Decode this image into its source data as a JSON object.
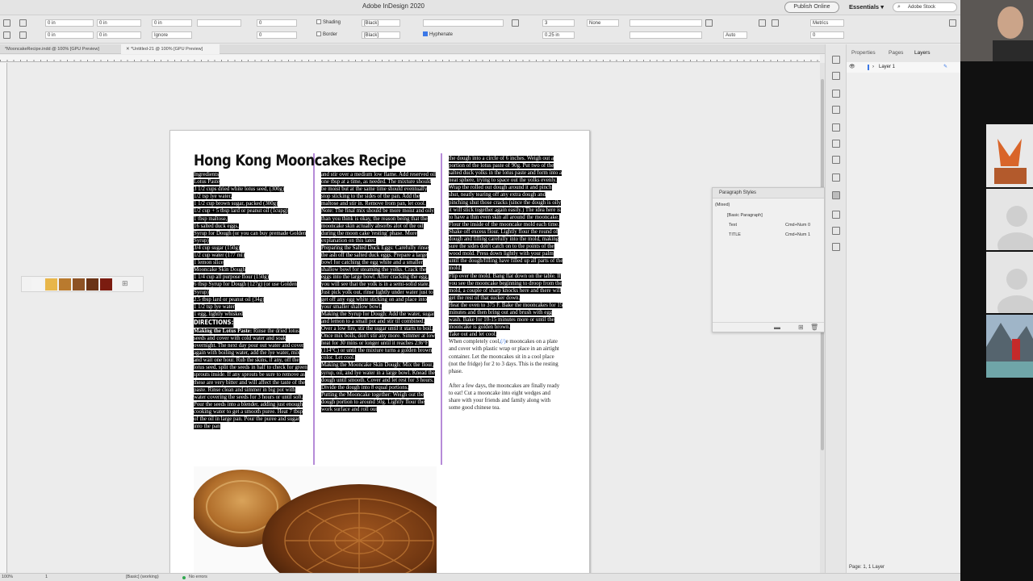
{
  "window": {
    "app_title": "Adobe InDesign 2020"
  },
  "topbar": {
    "publish_label": "Publish Online",
    "workspace_label": "Essentials",
    "stock_placeholder": "Adobe Stock"
  },
  "control": {
    "x_top": "0 in",
    "x_bottom": "0 in",
    "field_a_top": "0 in",
    "field_a_bottom": "0 in",
    "field_b_top": "0 in",
    "field_b_bottom": "Ignore",
    "field_c_top": "0",
    "field_c_bottom": "0",
    "shading_label": "Shading",
    "border_label": "Border",
    "shading_color": "[Black]",
    "border_color": "[Black]",
    "hyphenate_label": "Hyphenate",
    "columns_value": "3",
    "gutter_value": "0.25 in",
    "none_label": "None",
    "autofit_label": "Auto",
    "metrics_label": "Metrics",
    "tracking_value": "0",
    "leading_value": "0"
  },
  "tabs": [
    {
      "label": "*MooncakeRecipe.indd @ 100% [GPU Preview]"
    },
    {
      "label": "*Untitled-21 @ 100% [GPU Preview]"
    }
  ],
  "document": {
    "title": "Hong Kong Mooncakes Recipe",
    "col1": {
      "ingredients_head": "Ingredients",
      "lotus_head": "Lotus Paste",
      "ingredients": [
        "3 1/2 cups dried white lotus seed, (300g)",
        "1/2 tsp lye water,",
        "1 1/2 cup brown sugar, packed (300g)",
        "1/2 cup + 5 tbsp lard or peanut oil (1cupg)",
        "1 tbsp maltose,",
        "16 salted duck eggs,",
        "Syrup for Dough (or you can buy premade Golden Syrup)",
        "3/4 cup sugar (150g)",
        "1/2 cup water (177 ml)",
        "1 lemon slice",
        "Mooncake Skin Dough",
        "1 1/4 cup all purpose flour (150g)",
        "6 tbsp Syrup for Dough (127g) (or use Golden Syrup)",
        "2.5 tbsp lard or peanut oil (34g)",
        "1 1/2 tsp lye water",
        "1 egg, lightly whisked"
      ],
      "directions_head": "DIRECTIONS:",
      "lotus_step_head": "Making the Lotus Paste:",
      "lotus_step": "Rinse the dried lotus seeds and cover with cold water and soak overnight. The next day pour out water and cover again with boiling water, add the lye water, mix and wait one hour. Rub the skins, if any, off the lotus seed, split the seeds in half to check for green sprouts inside. If any sprouts be sure to remove as these are very bitter and will affect the taste of the paste. Rinse clean and simmer in big pot with water covering the seeds for 3 hours or until soft. Pour the seeds into a blender, adding just enough cooking water to get a smooth puree. Heat 7 tbsp of the oil in large pan. Pour the puree and sugar into the pan"
    },
    "col2": {
      "p1": "and stir over a medium low flame. Add reserved oil one tbsp at a time, as needed. The mixture should be moist but at the same time should eventually stop sticking to the sides of the pan. Add the maltose and stir in. Remove from pan, let cool. Note: The final mix should be more moist and oily than you think is okay, the reason being that the mooncake skin actually absorbs alot of the oil during the moon cake 'resting' phase. More explanation on this later.",
      "p2": "Preparing the Salted Duck Eggs: Carefully rinse the ash off the salted duck eggs. Prepare a large bowl for catching the egg white and a smaller shallow bowl for steaming the yolks. Crack the eggs into the large bowl. After cracking the egg, you will see that the yolk is in a semi-solid state. Just pick yolk out, rinse lightly under water just to get off any egg white sticking on and place into your smaller shallow bowl.",
      "p3": "Making the Syrup for Dough: Add the water, sugar and lemon to a small pot and stir til combined. Over a low fire, stir the sugar until it starts to boil. Once mix boils, don't stir any more. Simmer at low heat for 30 mins or longer until it reaches 236°F (114°C) or until the mixture turns a golden brown color. Let cool.",
      "p4": "Making the Mooncake Skin Dough: Mix the flour, syrup, oil, and lye water in a large bowl. Knead the dough until smooth. Cover and let rest for 3 hours. Divide the dough into 8 equal portions.",
      "p5": "Putting the Mooncake together: Weigh out the dough portion to around 50g. Lightly flour the work surface and roll out"
    },
    "col3": {
      "p1": "the dough into a circle of 6 inches. Weigh out a portion of the lotus paste of 90g. Put two of the salted duck yolks in the lotus paste and form into a neat sphere, trying to space out the yolks evenly. Wrap the rolled out dough around it and pinch shut, neatly tearing off any extra dough and pinching shut those cracks (since the dough is oily it will stick together again easily.) The idea here is to have a thin even skin all around the mooncake.",
      "p2": "Flour the inside of the mooncake mold each time. Shake off excess flour. Lightly flour the round of dough and filling carefully into the mold, making sure the sides don't catch on to the points of the wood mold. Press down lightly with your palm until the dough/filling have filled up all parts of the mold.",
      "p3": "Flip over the mold. Bang flat down on the table. If you see the mooncake beginning to droop from the mold, a couple of sharp knocks here and there will get the rest of that sucker down.",
      "p4": "Heat the oven to 375 F. Bake the mooncakes for 15 minutes and then bring out and brush with egg wash. Bake for 10-15 minutes more or until the mooncake is golden brown.",
      "p5": "Take out and let cool.",
      "p6_a": "When completely cool,",
      "p6_cursor": "(/)",
      "p6_b": "e mooncakes on a plate and cover with plastic wrap or place in an airtight container. Let the mooncakes sit in a cool place (not the fridge) for 2 to 3 days. This is the resting phase.",
      "p7": "After a few days, the mooncakes are finally ready to eat! Cut a mooncake into eight wedges and share with your friends and family along with some good chinese tea."
    }
  },
  "swatches": {
    "colors": [
      "#f4f4f4",
      "#e8b64a",
      "#b97a2e",
      "#8d5224",
      "#6b3416",
      "#7b1c10"
    ]
  },
  "right_panel": {
    "tabs": [
      "Properties",
      "Pages",
      "Layers"
    ],
    "active_tab": "Layers",
    "layer_name": "Layer 1",
    "footer": "Page: 1, 1 Layer"
  },
  "paragraph_styles": {
    "title": "Paragraph Styles",
    "current": "(Mixed)",
    "styles": [
      {
        "name": "[Basic Paragraph]",
        "shortcut": ""
      },
      {
        "name": "Text",
        "shortcut": "Cmd+Num 0"
      },
      {
        "name": "TITLE",
        "shortcut": "Cmd+Num 1"
      }
    ]
  },
  "status": {
    "zoom": "100%",
    "page": "1",
    "style_state": "[Basic] (working)",
    "errors": "No errors"
  },
  "colors": {
    "selection": "#000000",
    "frame_guide": "#b68bd8",
    "accent": "#3b78e7"
  }
}
